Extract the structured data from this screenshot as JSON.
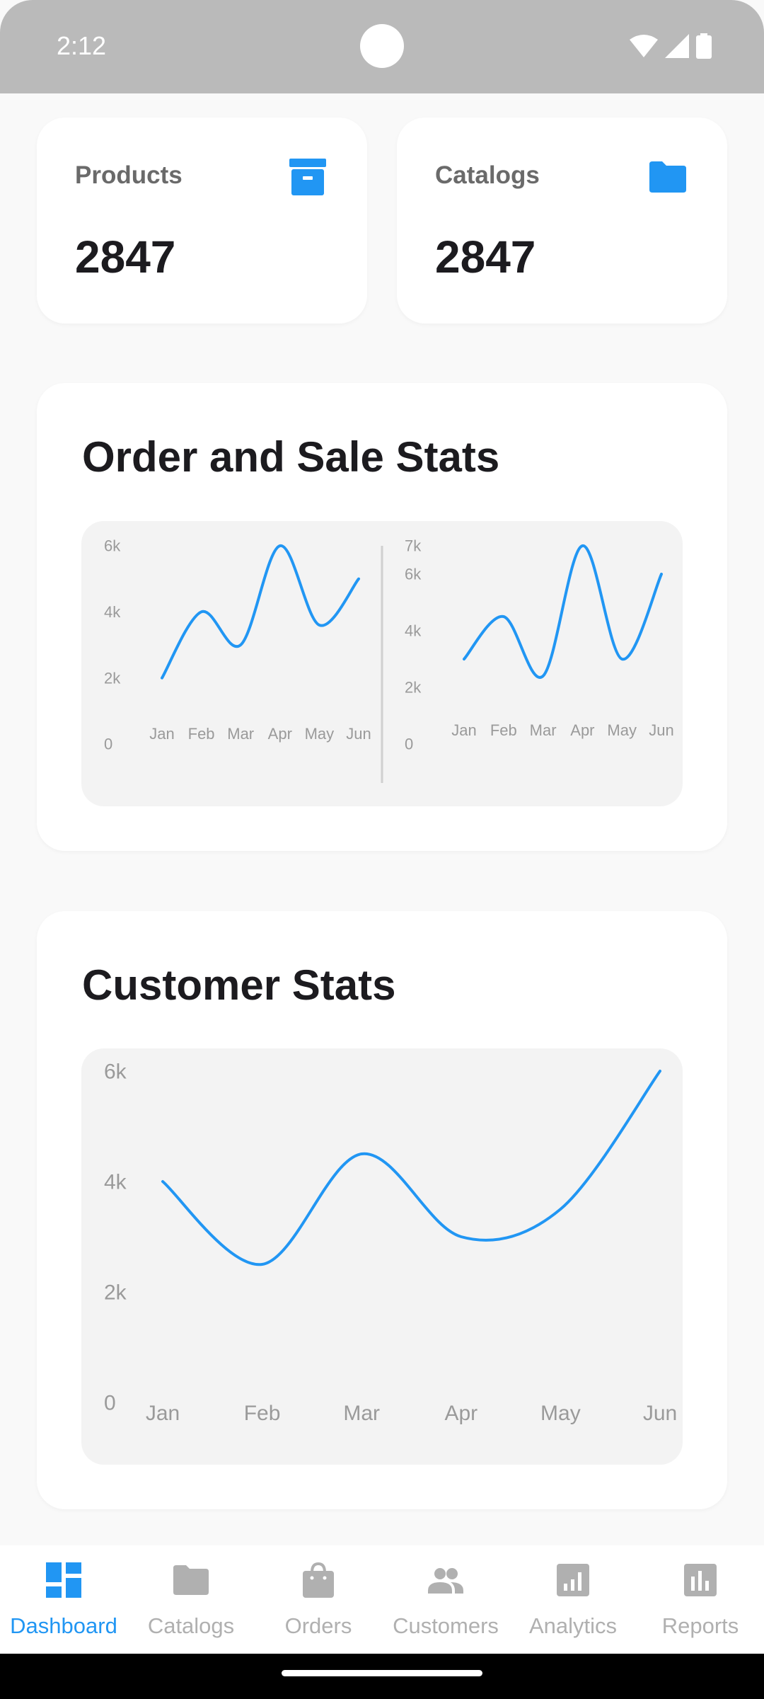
{
  "status_bar": {
    "time": "2:12"
  },
  "stats": [
    {
      "label": "Products",
      "value": "2847",
      "icon": "archive-icon"
    },
    {
      "label": "Catalogs",
      "value": "2847",
      "icon": "folder-icon"
    }
  ],
  "order_section": {
    "title": "Order and Sale Stats"
  },
  "customer_section": {
    "title": "Customer Stats"
  },
  "colors": {
    "accent": "#2196f3",
    "muted": "#b0b0b0",
    "axis_text": "#9a9a9a"
  },
  "chart_data": [
    {
      "type": "line",
      "categories": [
        "Jan",
        "Feb",
        "Mar",
        "Apr",
        "May",
        "Jun"
      ],
      "series": [
        {
          "values": [
            2000,
            4000,
            3000,
            6000,
            3600,
            5000
          ]
        }
      ],
      "y_ticks": [
        "0",
        "2k",
        "4k",
        "6k"
      ],
      "ylim": [
        0,
        6000
      ],
      "grid": false
    },
    {
      "type": "line",
      "categories": [
        "Jan",
        "Feb",
        "Mar",
        "Apr",
        "May",
        "Jun"
      ],
      "series": [
        {
          "values": [
            3000,
            4500,
            2400,
            7000,
            3000,
            6000
          ]
        }
      ],
      "y_ticks": [
        "0",
        "2k",
        "4k",
        "6k",
        "7k"
      ],
      "ylim": [
        0,
        7000
      ],
      "grid": false
    },
    {
      "type": "line",
      "categories": [
        "Jan",
        "Feb",
        "Mar",
        "Apr",
        "May",
        "Jun"
      ],
      "series": [
        {
          "values": [
            4000,
            2500,
            4500,
            3000,
            3500,
            6000
          ]
        }
      ],
      "y_ticks": [
        "0",
        "2k",
        "4k",
        "6k"
      ],
      "ylim": [
        0,
        6000
      ],
      "grid": false
    }
  ],
  "bottom_nav": [
    {
      "label": "Dashboard",
      "icon": "dashboard-icon",
      "active": true
    },
    {
      "label": "Catalogs",
      "icon": "folder-icon",
      "active": false
    },
    {
      "label": "Orders",
      "icon": "shopping-bag-icon",
      "active": false
    },
    {
      "label": "Customers",
      "icon": "people-icon",
      "active": false
    },
    {
      "label": "Analytics",
      "icon": "analytics-icon",
      "active": false
    },
    {
      "label": "Reports",
      "icon": "bar-chart-icon",
      "active": false
    }
  ]
}
